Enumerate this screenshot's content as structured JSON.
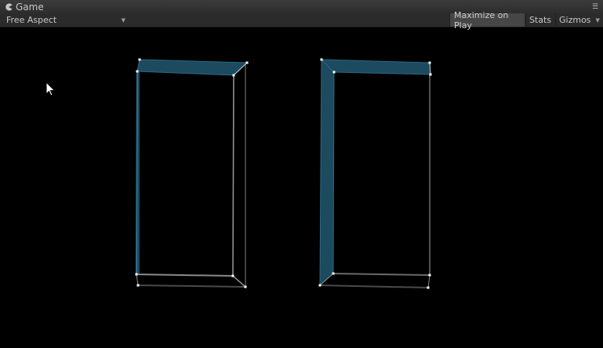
{
  "window": {
    "tab_title": "Game",
    "tab_icon": "pacman-icon",
    "menu_icon": "context-menu-icon"
  },
  "toolbar": {
    "aspect_label": "Free Aspect",
    "maximize_label": "Maximize on Play",
    "stats_label": "Stats",
    "gizmos_label": "Gizmos",
    "gizmos_caret_icon": "dropdown-caret-icon"
  },
  "scene": {
    "background_color": "#000000",
    "highlight_color": "#1c4a5e",
    "edge_color": "#d9d9d9",
    "objects": [
      "door-frame-left",
      "door-frame-right"
    ]
  },
  "cursor_icon": "mouse-pointer-icon"
}
